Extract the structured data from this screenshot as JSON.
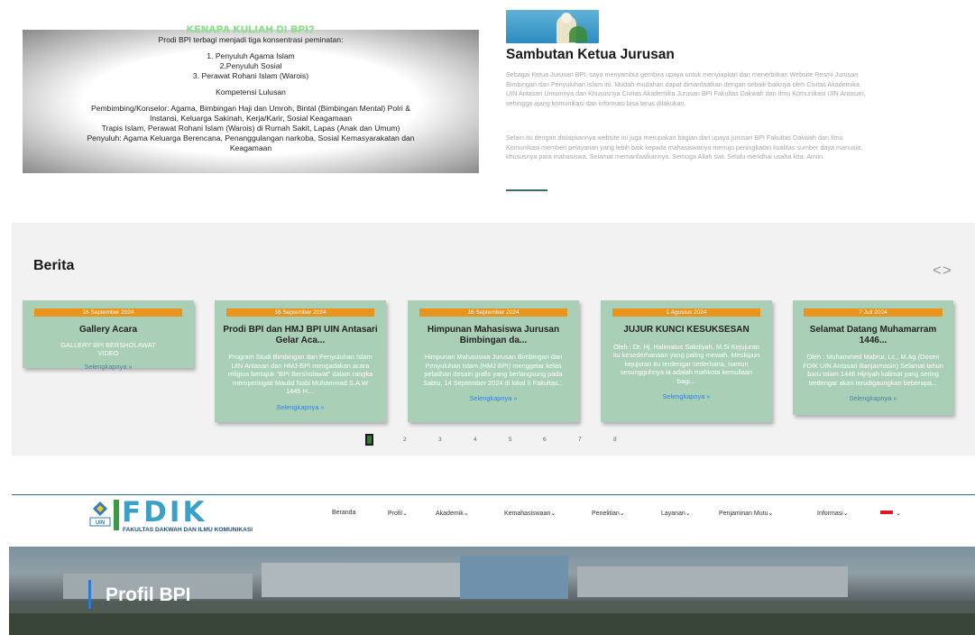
{
  "why": {
    "title": "KENAPA KULIAH DI BPI?",
    "intro": "Prodi BPI terbagi menjadi tiga konsentrasi peminatan:",
    "items": [
      "1. Penyuluh Agama Islam",
      "2.Penyuluh Sosial",
      "3. Perawat Rohani Islam (Warois)"
    ],
    "kompetensi_label": "Kompetensi Lulusan",
    "kompetensi": [
      "Pembimbing/Konselor: Agama, Bimbingan Haji dan Umroh, Bintal (Bimbingan Mental) Polri &",
      "Instansi, Keluarga Sakinah, Kerja/Karir, Sosial Keagamaan",
      "Trapis Islam, Perawat Rohani Islam (Warois) di Rumah Sakit, Lapas (Anak dan Umum)",
      "Penyuluh: Agama Keluarga Berencana, Penanggulangan narkoba, Sosial Kemasyarakatan dan",
      "Keagamaan"
    ]
  },
  "sambutan": {
    "title": "Sambutan Ketua Jurusan",
    "p1": "Sebagai Ketua Jurusan BPI, saya menyambut gembira upaya untuk menyiapkan dan menerbitkan Website Resmi Jurusan Bimbingan dan Penyuluhan Islam ini. Mudah-mudahan dapat dimanfaatkan dengan sebaik-baiknya oleh Civitas Akademika UIN Antasari Umumnya dan Khususnya Civitas Akademika Jurusan BPI Fakultas Dakwah dan Ilmu Komunikasi UIN Antasari, sehingga ajang komunikasi dan informasi bisa terus dilakukan.",
    "p2": "Selain itu dengan disiapkannya website ini juga merupakan bagian dari upaya jurusan BPI Fakultas Dakwah dan Ilmu Komunikasi memberi pelayanan yang lebih baik kepada mahasiswanya menuju peningkatan kualitas sumber daya manusia, khususnya para mahasiswa. Selamat memanfaatkannya. Semoga Allah swt. Selalu meridhai usaha kita. Amiin."
  },
  "berita": {
    "title": "Berita",
    "arrows": "<>",
    "more_label": "Selengkapnya »",
    "cards": [
      {
        "date": "16 September 2024",
        "title": "Gallery Acara",
        "desc": "GALLERY BPI BERSHOLAWAT VIDEO"
      },
      {
        "date": "16 September 2024",
        "title": "Prodi BPI dan HMJ BPI UIN Antasari Gelar Aca...",
        "desc": "Program Studi Bimbingan dan Penyuluhan Islam UIN Antasari dan HMJ-BPI mengadakan acara religius bertajuk \"BPI Bersholawat\" dalam rangka memperingati Maulid Nabi Muhammad S.A.W 1445 H...."
      },
      {
        "date": "16 September 2024",
        "title": "Himpunan Mahasiswa Jurusan Bimbingan da...",
        "desc": "Himpunan Mahasiswa Jurusan Bimbingan dan Penyuluhan Islam (HMJ BPI) menggelar kelas pelatihan desain grafis yang berlangsung pada Sabtu, 14 September 2024 di lokal II Fakultas..."
      },
      {
        "date": "1 Agustus 2024",
        "title": "JUJUR KUNCI KESUKSESAN",
        "desc": "Oleh : Dr. Hj. Halimatus Sakdiyah, M.Si Kejujuran itu kesederhanaan yang paling mewah. Meskipun kejujuran itu terdengar sederhana, namun sesungguhnya ia adalah mahkota kemuliaan bagi..."
      },
      {
        "date": "7 Juli 2024",
        "title": "Selamat Datang Muhamarram 1446...",
        "desc": "Oleh : Muhammed Mabrur, Lc., M.Ag (Dosen FDIK UIN Antasari Banjarmasin) Selamat tahun baru Islam 1446 Hijriyah kalimat yang sering terdengar akan terudigaungkan beberapa..."
      }
    ],
    "pages": [
      "2",
      "3",
      "4",
      "5",
      "6",
      "7",
      "8"
    ]
  },
  "header": {
    "logo_text": "FDIK",
    "logo_sub": "FAKULTAS DAKWAH DAN ILMU KOMUNIKASI",
    "nav": [
      "Beranda",
      "Profil",
      "Akademik",
      "Kemahasiswaan",
      "Penelitian",
      "Layanan",
      "Penjaminan Mutu",
      "Informasi"
    ]
  },
  "banner": {
    "title": "Profil BPI"
  }
}
